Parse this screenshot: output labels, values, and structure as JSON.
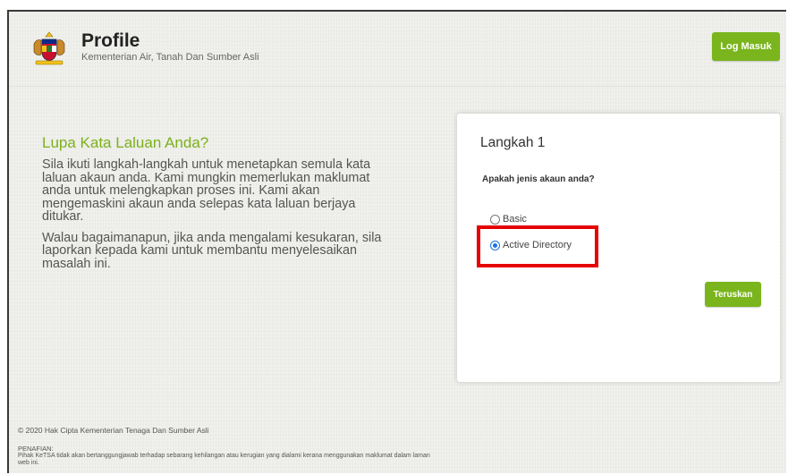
{
  "header": {
    "title": "Profile",
    "subtitle": "Kementerian Air, Tanah Dan Sumber Asli",
    "login_label": "Log Masuk"
  },
  "intro": {
    "heading": "Lupa Kata Laluan Anda?",
    "paragraph1": "Sila ikuti langkah-langkah untuk menetapkan semula kata laluan akaun anda. Kami mungkin memerlukan maklumat anda untuk melengkapkan proses ini. Kami akan mengemaskini akaun anda selepas kata laluan berjaya ditukar.",
    "paragraph2": "Walau bagaimanapun, jika anda mengalami kesukaran, sila laporkan kepada kami untuk membantu menyelesaikan masalah ini."
  },
  "card": {
    "step_title": "Langkah 1",
    "question": "Apakah jenis akaun anda?",
    "options": [
      {
        "label": "Basic",
        "selected": false
      },
      {
        "label": "Active Directory",
        "selected": true
      }
    ],
    "next_label": "Teruskan"
  },
  "footer": {
    "copyright": "© 2020 Hak Cipta Kementerian Tenaga Dan Sumber Asli",
    "disclaimer_title": "PENAFIAN:",
    "disclaimer_text": "Pihak KeTSA tidak akan bertanggungjawab terhadap sebarang kehilangan atau kerugian yang dialami kerana menggunakan maklumat dalam laman web ini."
  },
  "colors": {
    "accent": "#7ab51d",
    "highlight": "#e60000",
    "radio_selected": "#1a73e8"
  },
  "icons": {
    "logo": "malaysia-coat-of-arms-icon"
  }
}
